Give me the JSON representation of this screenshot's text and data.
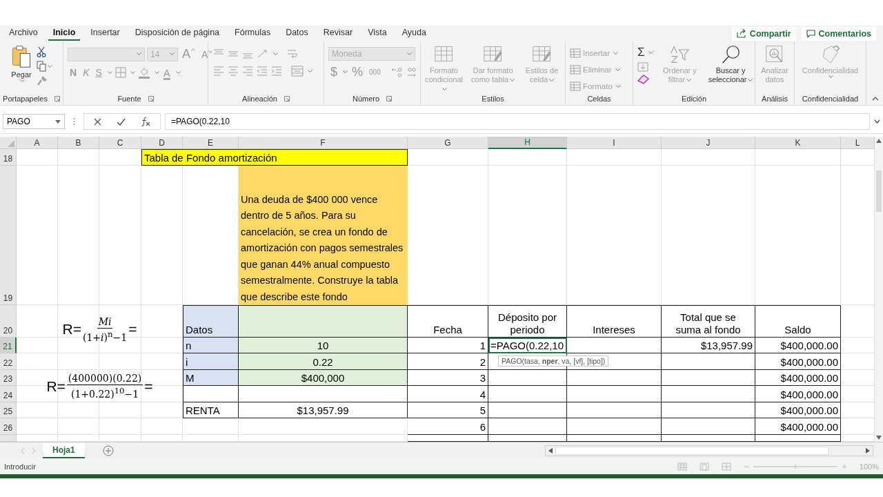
{
  "menu_tabs": [
    {
      "label": "Archivo",
      "selected": false
    },
    {
      "label": "Inicio",
      "selected": true
    },
    {
      "label": "Insertar",
      "selected": false
    },
    {
      "label": "Disposición de página",
      "selected": false
    },
    {
      "label": "Fórmulas",
      "selected": false
    },
    {
      "label": "Datos",
      "selected": false
    },
    {
      "label": "Revisar",
      "selected": false
    },
    {
      "label": "Vista",
      "selected": false
    },
    {
      "label": "Ayuda",
      "selected": false
    }
  ],
  "share_buttons": [
    "Compartir",
    "Comentarios"
  ],
  "ribbon": {
    "groups": [
      {
        "label": "Portapapeles",
        "items": [
          {
            "label": "Pegar",
            "disabled": false
          },
          {
            "disabled": false
          },
          {
            "disabled": false
          },
          {
            "disabled": true
          }
        ]
      },
      {
        "label": "Fuente",
        "items": [
          {
            "disabled": true
          },
          {
            "value": "14",
            "disabled": true
          },
          {
            "label": "A",
            "disabled": true
          },
          {
            "label": "A",
            "disabled": true
          },
          {
            "label": "N",
            "disabled": true
          },
          {
            "label": "K",
            "disabled": true
          },
          {
            "label": "S",
            "disabled": true
          },
          {
            "disabled": true
          },
          {
            "disabled": true
          },
          {
            "label": "A",
            "disabled": true
          }
        ]
      },
      {
        "label": "Alineación",
        "items": [
          {
            "disabled": true
          },
          {
            "disabled": true
          },
          {
            "disabled": true
          },
          {
            "disabled": true
          },
          {
            "disabled": true
          },
          {
            "disabled": true
          },
          {
            "disabled": true
          },
          {
            "disabled": true
          },
          {
            "disabled": true
          },
          {
            "disabled": true
          },
          {
            "disabled": true
          }
        ]
      },
      {
        "label": "Número",
        "items": [
          {
            "value": "Moneda",
            "disabled": true
          },
          {
            "label": "$",
            "disabled": true
          },
          {
            "label": "%",
            "disabled": true
          },
          {
            "label": "000",
            "disabled": true
          },
          {
            "disabled": true
          },
          {
            "disabled": true
          }
        ]
      },
      {
        "label": "Estilos",
        "items": [
          {
            "label": "Formato condicional",
            "disabled": true
          },
          {
            "label": "Dar formato como tabla",
            "disabled": true
          },
          {
            "label": "Estilos de celda",
            "disabled": true
          }
        ]
      },
      {
        "label": "Celdas",
        "items": [
          {
            "label": "Insertar",
            "disabled": true
          },
          {
            "label": "Eliminar",
            "disabled": true
          },
          {
            "label": "Formato",
            "disabled": true
          }
        ]
      },
      {
        "label": "Edición",
        "items": [
          {
            "label": "Σ",
            "disabled": false
          },
          {
            "disabled": true
          },
          {
            "disabled": false
          },
          {
            "label": "Ordenar y filtrar",
            "disabled": true
          },
          {
            "label": "Buscar y seleccionar",
            "disabled": false
          }
        ]
      },
      {
        "label": "Análisis",
        "items": [
          {
            "label": "Analizar datos",
            "disabled": true
          }
        ]
      },
      {
        "label": "Confidencialidad",
        "items": [
          {
            "label": "Confidencialidad",
            "disabled": true
          }
        ]
      }
    ]
  },
  "formula_bar": {
    "name_box": "PAGO",
    "formula": "=PAGO(0.22,10"
  },
  "sheet": {
    "columns": [
      {
        "label": "A",
        "selected": false
      },
      {
        "label": "B",
        "selected": false
      },
      {
        "label": "C",
        "selected": false
      },
      {
        "label": "D",
        "selected": false
      },
      {
        "label": "E",
        "selected": false
      },
      {
        "label": "F",
        "selected": false
      },
      {
        "label": "G",
        "selected": false
      },
      {
        "label": "H",
        "selected": true
      },
      {
        "label": "I",
        "selected": false
      },
      {
        "label": "J",
        "selected": false
      },
      {
        "label": "K",
        "selected": false
      },
      {
        "label": "L",
        "selected": false
      }
    ],
    "rows": [
      {
        "label": "18",
        "selected": false
      },
      {
        "label": "19",
        "selected": false
      },
      {
        "label": "20",
        "selected": false
      },
      {
        "label": "21",
        "selected": true
      },
      {
        "label": "22",
        "selected": false
      },
      {
        "label": "23",
        "selected": false
      },
      {
        "label": "24",
        "selected": false
      },
      {
        "label": "25",
        "selected": false
      },
      {
        "label": "26",
        "selected": false
      }
    ],
    "title_cell": "Tabla de Fondo amortización",
    "problem_text": "Una deuda de $400 000 vence dentro de 5 años. Para su cancelación, se crea un fondo de amortización con pagos semestrales que ganan 44% anual compuesto semestralmente. Construye la tabla que describe este fondo",
    "formulas": [
      {
        "lhs": "R=",
        "numerator": "*Mi*",
        "denominator": "(1+*i*)$^{n}$−1",
        "rhs": "="
      },
      {
        "lhs": "R=",
        "numerator": "(400000)(0.22)",
        "denominator": "(1+0.22)$^{10}$−1",
        "rhs": "="
      }
    ],
    "datos_table": {
      "header": "Datos",
      "rows": [
        {
          "label": "n",
          "value": "10"
        },
        {
          "label": "i",
          "value": "0.22"
        },
        {
          "label": "M",
          "value": "$400,000"
        },
        {},
        {
          "label": "RENTA",
          "value": "$13,957.99"
        }
      ]
    },
    "fund_table": {
      "columns": [
        "Fecha",
        "Déposito por periodo",
        "Intereses",
        "Total que se suma al fondo",
        "Saldo"
      ],
      "rows": [
        {
          "fecha": "1",
          "deposito": "=PAGO(0.22,10",
          "total": "$13,957.99",
          "saldo": "$400,000.00",
          "selected": true
        },
        {
          "fecha": "2",
          "saldo": "$400,000.00",
          "selected": false
        },
        {
          "fecha": "3",
          "saldo": "$400,000.00",
          "selected": false
        },
        {
          "fecha": "4",
          "saldo": "$400,000.00",
          "selected": false
        },
        {
          "fecha": "5",
          "saldo": "$400,000.00",
          "selected": false
        },
        {
          "fecha": "6",
          "saldo": "$400,000.00",
          "selected": false
        }
      ]
    },
    "tooltip": "PAGO(tasa, **nper**, va, [vf], [tipo])"
  },
  "sheet_tabs": [
    {
      "label": "Hoja1",
      "selected": true
    }
  ],
  "status_bar": {
    "mode": "Introducir",
    "zoom": "100%"
  }
}
